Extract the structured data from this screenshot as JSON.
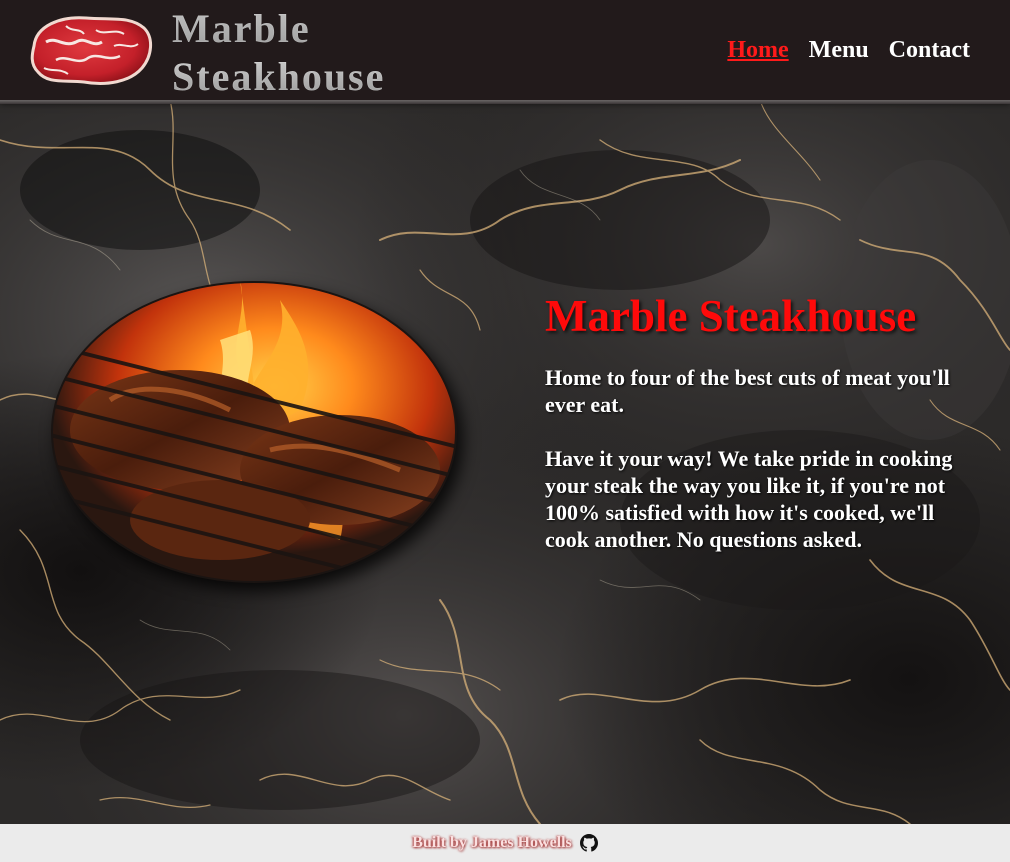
{
  "header": {
    "brand_line1": "Marble",
    "brand_line2": "Steakhouse",
    "logo_icon": "raw-steak-logo",
    "nav": [
      {
        "label": "Home",
        "active": true
      },
      {
        "label": "Menu",
        "active": false
      },
      {
        "label": "Contact",
        "active": false
      }
    ]
  },
  "hero": {
    "image_icon": "grilling-steaks-image",
    "title": "Marble Steakhouse",
    "paragraph1": "Home to four of the best cuts of meat you'll ever eat.",
    "paragraph2": "Have it your way! We take pride in cooking your steak the way you like it, if you're not 100% satisfied with how it's cooked, we'll cook another. No questions asked."
  },
  "footer": {
    "credit": "Built by James Howells",
    "icon": "github-icon"
  },
  "colors": {
    "header_bg": "#221a1b",
    "accent_red": "#ff0a0a",
    "footer_bg": "#ebebeb",
    "marble_vein": "#d8b27a"
  }
}
